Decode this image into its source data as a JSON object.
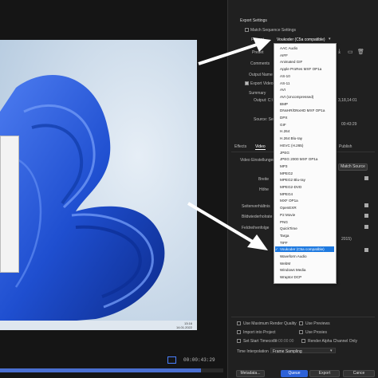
{
  "preview": {
    "taskbar_time": "13:16",
    "taskbar_date": "14.01.2022",
    "timecode": "00:00:43:29",
    "timeline_progress": 0.9
  },
  "export_settings": {
    "header": "Export Settings",
    "match_sequence_label": "Match Sequence Settings",
    "format_value": "Voukoder (C5a compatible)",
    "preset_label": "Preset",
    "comments_label": "Comments",
    "output_name_label": "Output Name",
    "export_video_label": "Export Video",
    "summary_label": "Summary",
    "output_label": "Output",
    "output_value": "C:\\",
    "output_side": "3,18,14:01",
    "source_label": "Source",
    "source_value": "Seq",
    "source_side": "00:43:29",
    "video_settings_label": "Video Einstellungen",
    "match_source_button": "Match Source",
    "width_label": "Breite",
    "height_label": "Höhe",
    "aspect_label": "Seitenverhältnis",
    "frame_rate_label": "Bildwiederholrate",
    "field_order_label": "Feldreihenfolge",
    "tail_value": "2015)"
  },
  "tabs": [
    "Effects",
    "Video",
    "Publish"
  ],
  "active_tab": "Video",
  "format_options": [
    "AAC Audio",
    "AIFF",
    "Animated GIF",
    "Apple ProRes MXF OP1a",
    "AS-10",
    "AS-11",
    "AVI",
    "AVI (Uncompressed)",
    "BMP",
    "DNxHR/DNxHD MXF OP1a",
    "DPX",
    "GIF",
    "H.264",
    "H.264 Blu-ray",
    "HEVC (H.265)",
    "JPEG",
    "JPEG 2000 MXF OP1a",
    "MP3",
    "MPEG2",
    "MPEG2 Blu-ray",
    "MPEG2-DVD",
    "MPEG4",
    "MXF OP1a",
    "OpenEXR",
    "P2 Movie",
    "PNG",
    "QuickTime",
    "Targa",
    "TIFF",
    "Voukoder (C5a compatible)",
    "Waveform Audio",
    "WebM",
    "Windows Media",
    "Wraptor DCP"
  ],
  "selected_format_index": 29,
  "bottom": {
    "max_render_quality": "Use Maximum Render Quality",
    "use_previews": "Use Previews",
    "import_into_project": "Import into Project",
    "use_proxies": "Use Proxies",
    "set_start_timecode": "Set Start Timecode",
    "start_timecode_value": "00:00:00:00",
    "render_alpha": "Render Alpha Channel Only",
    "time_interpolation_label": "Time Interpolation",
    "time_interpolation_value": "Frame Sampling",
    "metadata_button": "Metadata...",
    "queue_button": "Queue",
    "export_button": "Export",
    "cancel_button": "Cance"
  },
  "colors": {
    "accent": "#2d62d8",
    "selection": "#1f7ae0",
    "bloom": "#1f4fd0"
  }
}
